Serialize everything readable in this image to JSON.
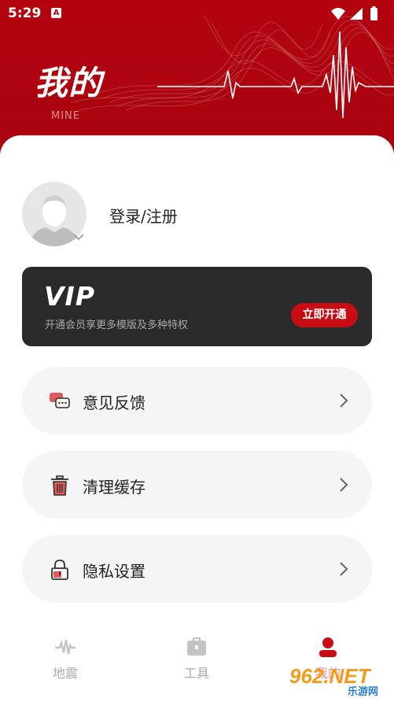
{
  "status_bar": {
    "time": "5:29",
    "notification_letter": "A"
  },
  "header": {
    "title": "我的",
    "subtitle": "MINE"
  },
  "profile": {
    "login_label": "登录/注册"
  },
  "vip": {
    "logo": "VIP",
    "description": "开通会员享更多模版及多种特权",
    "button_label": "立即开通"
  },
  "menu": [
    {
      "label": "意见反馈",
      "icon": "feedback-chat-icon"
    },
    {
      "label": "清理缓存",
      "icon": "trash-icon"
    },
    {
      "label": "隐私设置",
      "icon": "lock-icon"
    }
  ],
  "tabs": [
    {
      "label": "地震",
      "icon": "pulse-icon"
    },
    {
      "label": "工具",
      "icon": "toolbox-icon"
    },
    {
      "label": "我的",
      "icon": "person-icon"
    }
  ],
  "watermark": {
    "text": "962.NET",
    "subtext": "乐游网"
  },
  "colors": {
    "brand_red": "#b3030f",
    "accent_red": "#c80c14",
    "vip_card": "#2a2a2a"
  }
}
